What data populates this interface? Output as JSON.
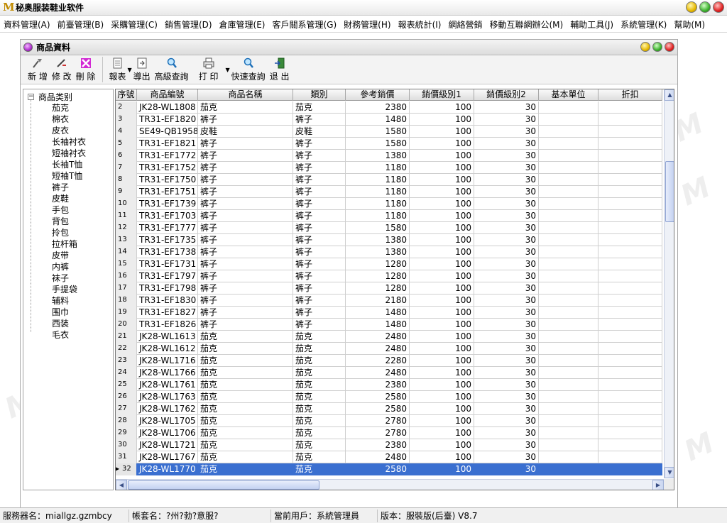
{
  "app": {
    "title": "秘奥服装鞋业软件",
    "logo": "M"
  },
  "menu": [
    "資料管理(A)",
    "前臺管理(B)",
    "采購管理(C)",
    "銷售管理(D)",
    "倉庫管理(E)",
    "客戶關系管理(G)",
    "財務管理(H)",
    "報表統計(I)",
    "網絡營銷",
    "移動互聯網辦公(M)",
    "輔助工具(J)",
    "系統管理(K)",
    "幫助(M)"
  ],
  "window": {
    "title": "商品資料"
  },
  "toolbar": {
    "add": "新 增",
    "edit": "修 改",
    "delete": "刪 除",
    "report": "報表",
    "export": "導出",
    "advanced_query": "高級查詢",
    "print": "打 印",
    "quick_query": "快速查詢",
    "exit": "退 出"
  },
  "tree": {
    "root": "商品类别",
    "items": [
      "茄克",
      "棉衣",
      "皮衣",
      "长袖衬衣",
      "短袖衬衣",
      "长袖T恤",
      "短袖T恤",
      "裤子",
      "皮鞋",
      "手包",
      "背包",
      "拎包",
      "拉杆箱",
      "皮带",
      "内裤",
      "袜子",
      "手提袋",
      "辅料",
      "围巾",
      "西装",
      "毛衣"
    ]
  },
  "grid": {
    "headers": [
      "序號",
      "商品編號",
      "商品名稱",
      "類別",
      "參考銷價",
      "銷價級別1",
      "銷價級別2",
      "基本單位",
      "折扣"
    ],
    "rows": [
      [
        "2",
        "JK28-WL1808",
        "茄克",
        "茄克",
        "2380",
        "100",
        "30"
      ],
      [
        "3",
        "TR31-EF1820",
        "裤子",
        "裤子",
        "1480",
        "100",
        "30"
      ],
      [
        "4",
        "SE49-QB1958",
        "皮鞋",
        "皮鞋",
        "1580",
        "100",
        "30"
      ],
      [
        "5",
        "TR31-EF1821",
        "裤子",
        "裤子",
        "1580",
        "100",
        "30"
      ],
      [
        "6",
        "TR31-EF1772",
        "裤子",
        "裤子",
        "1380",
        "100",
        "30"
      ],
      [
        "7",
        "TR31-EF1752",
        "裤子",
        "裤子",
        "1180",
        "100",
        "30"
      ],
      [
        "8",
        "TR31-EF1750",
        "裤子",
        "裤子",
        "1180",
        "100",
        "30"
      ],
      [
        "9",
        "TR31-EF1751",
        "裤子",
        "裤子",
        "1180",
        "100",
        "30"
      ],
      [
        "10",
        "TR31-EF1739",
        "裤子",
        "裤子",
        "1180",
        "100",
        "30"
      ],
      [
        "11",
        "TR31-EF1703",
        "裤子",
        "裤子",
        "1180",
        "100",
        "30"
      ],
      [
        "12",
        "TR31-EF1777",
        "裤子",
        "裤子",
        "1580",
        "100",
        "30"
      ],
      [
        "13",
        "TR31-EF1735",
        "裤子",
        "裤子",
        "1380",
        "100",
        "30"
      ],
      [
        "14",
        "TR31-EF1738",
        "裤子",
        "裤子",
        "1380",
        "100",
        "30"
      ],
      [
        "15",
        "TR31-EF1731",
        "裤子",
        "裤子",
        "1280",
        "100",
        "30"
      ],
      [
        "16",
        "TR31-EF1797",
        "裤子",
        "裤子",
        "1280",
        "100",
        "30"
      ],
      [
        "17",
        "TR31-EF1798",
        "裤子",
        "裤子",
        "1280",
        "100",
        "30"
      ],
      [
        "18",
        "TR31-EF1830",
        "裤子",
        "裤子",
        "2180",
        "100",
        "30"
      ],
      [
        "19",
        "TR31-EF1827",
        "裤子",
        "裤子",
        "1480",
        "100",
        "30"
      ],
      [
        "20",
        "TR31-EF1826",
        "裤子",
        "裤子",
        "1480",
        "100",
        "30"
      ],
      [
        "21",
        "JK28-WL1613",
        "茄克",
        "茄克",
        "2480",
        "100",
        "30"
      ],
      [
        "22",
        "JK28-WL1612",
        "茄克",
        "茄克",
        "2480",
        "100",
        "30"
      ],
      [
        "23",
        "JK28-WL1716",
        "茄克",
        "茄克",
        "2280",
        "100",
        "30"
      ],
      [
        "24",
        "JK28-WL1766",
        "茄克",
        "茄克",
        "2480",
        "100",
        "30"
      ],
      [
        "25",
        "JK28-WL1761",
        "茄克",
        "茄克",
        "2380",
        "100",
        "30"
      ],
      [
        "26",
        "JK28-WL1763",
        "茄克",
        "茄克",
        "2580",
        "100",
        "30"
      ],
      [
        "27",
        "JK28-WL1762",
        "茄克",
        "茄克",
        "2580",
        "100",
        "30"
      ],
      [
        "28",
        "JK28-WL1705",
        "茄克",
        "茄克",
        "2780",
        "100",
        "30"
      ],
      [
        "29",
        "JK28-WL1706",
        "茄克",
        "茄克",
        "2780",
        "100",
        "30"
      ],
      [
        "30",
        "JK28-WL1721",
        "茄克",
        "茄克",
        "2380",
        "100",
        "30"
      ],
      [
        "31",
        "JK28-WL1767",
        "茄克",
        "茄克",
        "2480",
        "100",
        "30"
      ],
      [
        "32",
        "JK28-WL1770",
        "茄克",
        "茄克",
        "2580",
        "100",
        "30"
      ]
    ],
    "selected_row": "32"
  },
  "status": {
    "server": "服務器名：miallgz.gzmbcy",
    "account": "帳套名：?州?勃?意服?",
    "user": "當前用戶：系統管理員",
    "version": "版本：服裝版(后臺) V8.7"
  },
  "colors": {
    "selection": "#3a6fd0",
    "header_bg": "#dedede"
  }
}
